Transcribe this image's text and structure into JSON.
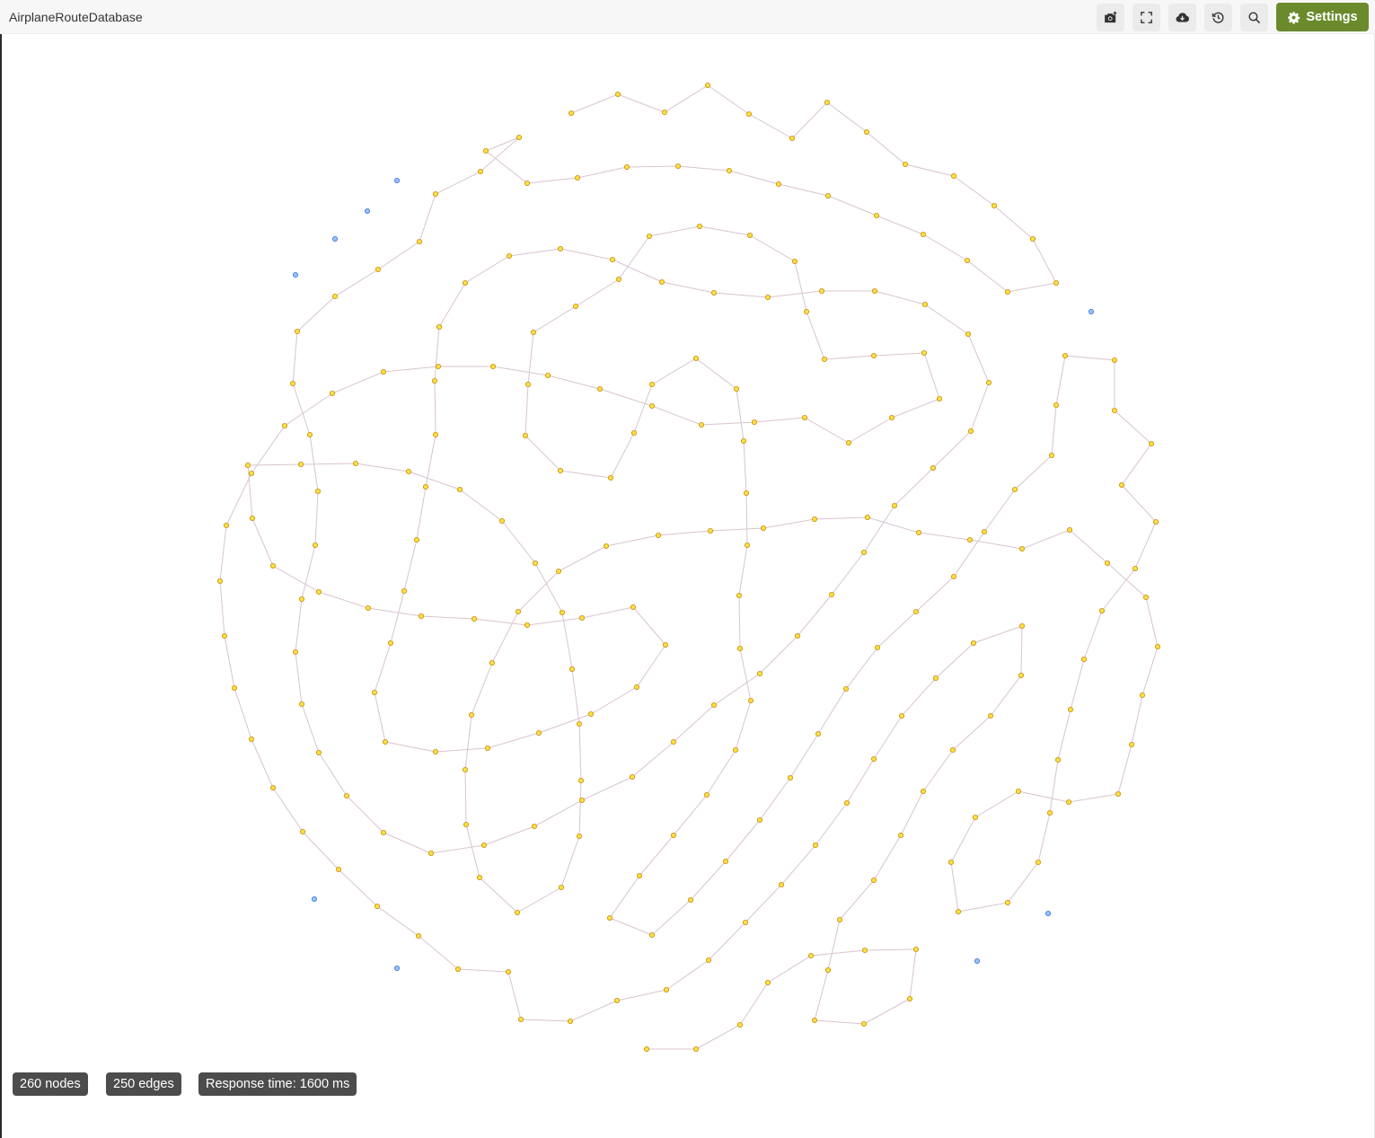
{
  "app": {
    "title": "AirplaneRouteDatabase"
  },
  "toolbar": {
    "buttons": [
      {
        "name": "snapshot-button",
        "icon": "camera-plus-icon"
      },
      {
        "name": "fullscreen-button",
        "icon": "fullscreen-icon"
      },
      {
        "name": "download-button",
        "icon": "cloud-download-icon"
      },
      {
        "name": "reset-button",
        "icon": "history-icon"
      },
      {
        "name": "search-button",
        "icon": "search-icon"
      }
    ],
    "settings_label": "Settings",
    "settings_icon": "gear-icon"
  },
  "stats": {
    "nodes": "260 nodes",
    "edges": "250 edges",
    "response": "Response time: 1600 ms"
  },
  "colors": {
    "connected_node": "#fde047",
    "connected_node_stroke": "#c98b00",
    "isolated_node": "#93c5fd",
    "isolated_node_stroke": "#3b6fd8",
    "edge": "#d8c4d2",
    "settings_button": "#6a8a2c",
    "stat_badge": "#4c4c4c"
  }
}
